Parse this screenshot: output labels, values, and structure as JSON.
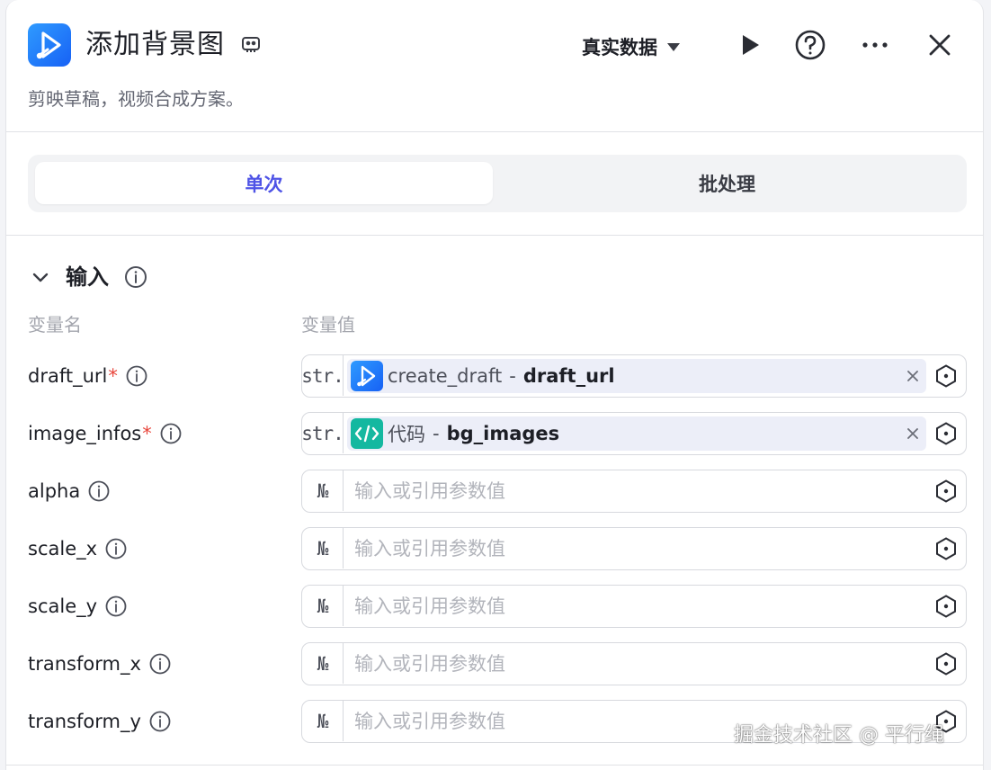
{
  "header": {
    "title": "添加背景图",
    "data_mode": "真实数据",
    "subtitle": "剪映草稿，视频合成方案。"
  },
  "tabs": [
    {
      "label": "单次",
      "active": true
    },
    {
      "label": "批处理",
      "active": false
    }
  ],
  "input_section": {
    "title": "输入",
    "col_name": "变量名",
    "col_value": "变量值",
    "rows": [
      {
        "name": "draft_url",
        "required": "*",
        "type": "str.",
        "source": "create_draft",
        "sep": "-",
        "variable": "draft_url"
      },
      {
        "name": "image_infos",
        "required": "*",
        "type": "str.",
        "source": "代码",
        "sep": "-",
        "variable": "bg_images"
      },
      {
        "name": "alpha",
        "type": "№",
        "placeholder": "输入或引用参数值"
      },
      {
        "name": "scale_x",
        "type": "№",
        "placeholder": "输入或引用参数值"
      },
      {
        "name": "scale_y",
        "type": "№",
        "placeholder": "输入或引用参数值"
      },
      {
        "name": "transform_x",
        "type": "№",
        "placeholder": "输入或引用参数值"
      },
      {
        "name": "transform_y",
        "type": "№",
        "placeholder": "输入或引用参数值"
      }
    ]
  },
  "watermark": "掘金技术社区 @ 平行绳",
  "colors": {
    "accent": "#4e53e6",
    "required": "#e8463c",
    "logo_blue": "#1f7bff",
    "code_green": "#14b8a0"
  },
  "icons": [
    "capcut-logo-icon",
    "bot-icon",
    "caret-down-icon",
    "play-icon",
    "help-icon",
    "more-icon",
    "close-icon",
    "chevron-down-icon",
    "info-icon",
    "code-icon",
    "clear-icon",
    "variable-ref-icon"
  ]
}
